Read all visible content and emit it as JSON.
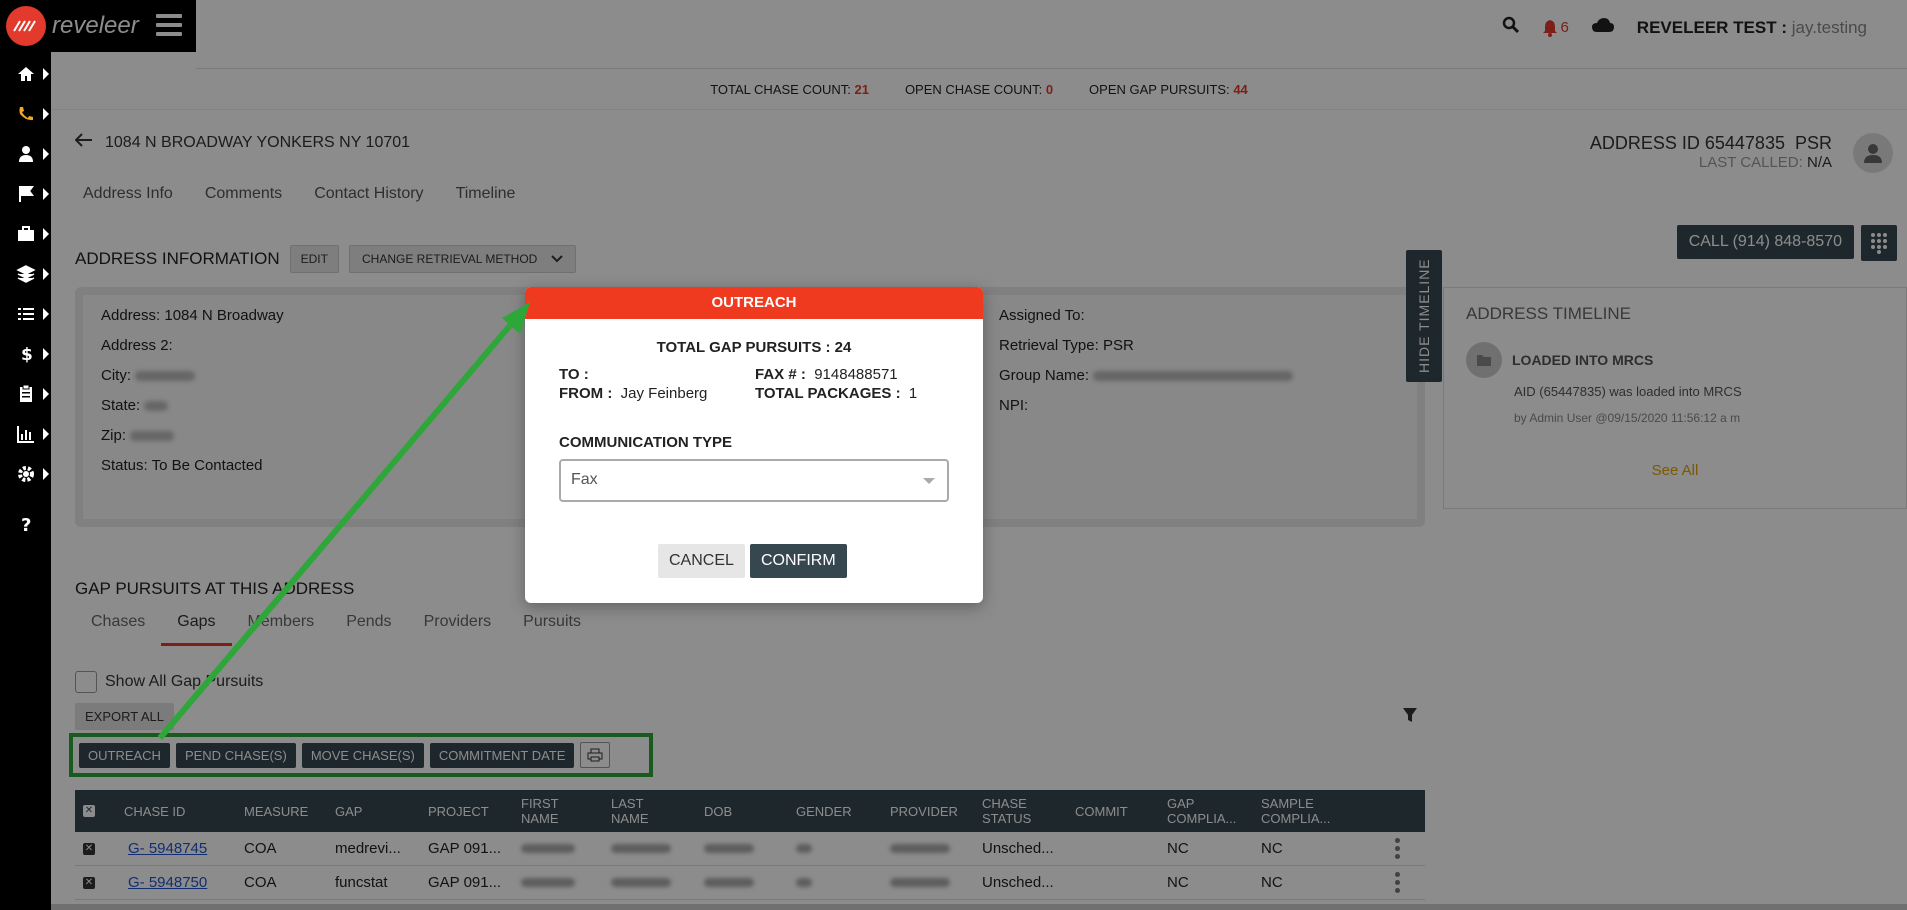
{
  "header": {
    "logo_text": "reveleer",
    "notification_count": "6",
    "user_label": "REVELEER TEST :",
    "user_name": "jay.testing"
  },
  "counts": {
    "total_label": "TOTAL CHASE COUNT:",
    "total_value": "21",
    "open_label": "OPEN CHASE COUNT:",
    "open_value": "0",
    "gap_label": "OPEN GAP PURSUITS:",
    "gap_value": "44"
  },
  "address": {
    "title": "1084 N BROADWAY YONKERS NY 10701",
    "id_label": "ADDRESS ID 65447835",
    "method": "PSR",
    "last_called_label": "LAST CALLED:",
    "last_called_value": "N/A"
  },
  "tabs": [
    "Address Info",
    "Comments",
    "Contact History",
    "Timeline"
  ],
  "address_info": {
    "title": "ADDRESS INFORMATION",
    "edit": "EDIT",
    "change_method": "CHANGE RETRIEVAL METHOD",
    "call": "CALL (914) 848-8570",
    "address_label": "Address:",
    "address_value": "1084 N Broadway",
    "address2_label": "Address 2:",
    "city_label": "City:",
    "state_label": "State:",
    "zip_label": "Zip:",
    "status_label": "Status:",
    "status_value": "To Be Contacted",
    "assigned_label": "Assigned To:",
    "retrieval_label": "Retrieval Type:",
    "retrieval_value": "PSR",
    "group_label": "Group Name:",
    "npi_label": "NPI:"
  },
  "timeline": {
    "hide": "HIDE TIMELINE",
    "title": "ADDRESS TIMELINE",
    "event": "LOADED INTO MRCS",
    "desc": "AID (65447835) was loaded into MRCS",
    "by": "by Admin User @09/15/2020 11:56:12 a m",
    "see_all": "See All"
  },
  "gaps": {
    "title": "GAP PURSUITS AT THIS ADDRESS",
    "tabs": [
      "Chases",
      "Gaps",
      "Members",
      "Pends",
      "Providers",
      "Pursuits"
    ],
    "show_all": "Show All Gap Pursuits",
    "export": "EXPORT ALL",
    "actions": [
      "OUTREACH",
      "PEND CHASE(S)",
      "MOVE CHASE(S)",
      "COMMITMENT DATE"
    ]
  },
  "table": {
    "headers": [
      "CHASE ID",
      "MEASURE",
      "GAP",
      "PROJECT",
      "FIRST NAME",
      "LAST NAME",
      "DOB",
      "GENDER",
      "PROVIDER",
      "CHASE STATUS",
      "COMMIT",
      "GAP COMPLIA...",
      "SAMPLE COMPLIA..."
    ],
    "rows": [
      {
        "prefix": "G-",
        "id": "5948745",
        "measure": "COA",
        "gap": "medrevi...",
        "project": "GAP 091...",
        "status": "Unsched...",
        "gap_comp": "NC",
        "sample_comp": "NC"
      },
      {
        "prefix": "G-",
        "id": "5948750",
        "measure": "COA",
        "gap": "funcstat",
        "project": "GAP 091...",
        "status": "Unsched...",
        "gap_comp": "NC",
        "sample_comp": "NC"
      }
    ]
  },
  "modal": {
    "title": "OUTREACH",
    "total": "TOTAL GAP PURSUITS : 24",
    "to_label": "TO :",
    "from_label": "FROM :",
    "from_value": "Jay Feinberg",
    "fax_label": "FAX # :",
    "fax_value": "9148488571",
    "packages_label": "TOTAL PACKAGES :",
    "packages_value": "1",
    "comm_label": "COMMUNICATION TYPE",
    "comm_value": "Fax",
    "cancel": "CANCEL",
    "confirm": "CONFIRM"
  },
  "colors": {
    "brand_red": "#e23a2c",
    "dark_button": "#37474f",
    "annotation_green": "#2fa63a",
    "see_all": "#e2a000"
  }
}
